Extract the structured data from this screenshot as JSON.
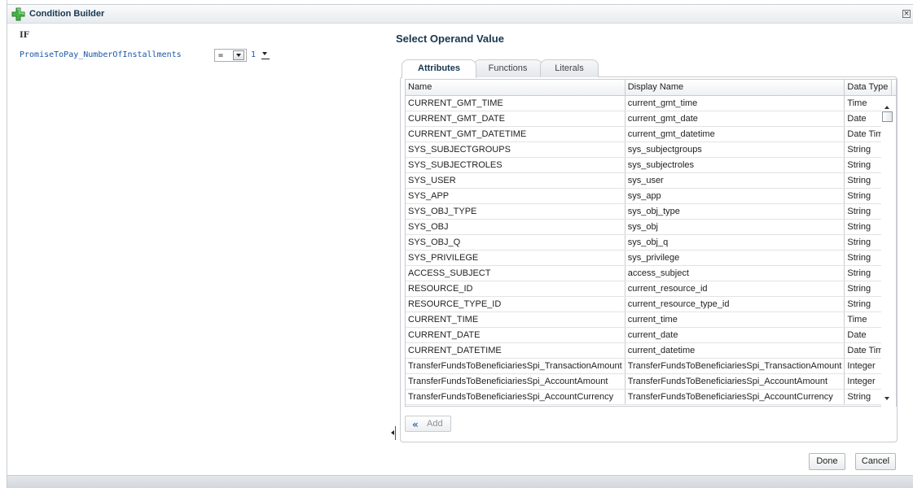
{
  "window": {
    "title": "Condition Builder"
  },
  "condition": {
    "keyword": "IF",
    "attribute": "PromiseToPay_NumberOfInstallments",
    "operator": "=",
    "operand": "1"
  },
  "operand_panel": {
    "title": "Select Operand Value",
    "tabs": [
      "Attributes",
      "Functions",
      "Literals"
    ],
    "active_tab": "Attributes",
    "columns": [
      "Name",
      "Display Name",
      "Data Type"
    ],
    "rows": [
      {
        "name": "CURRENT_GMT_TIME",
        "display": "current_gmt_time",
        "type": "Time"
      },
      {
        "name": "CURRENT_GMT_DATE",
        "display": "current_gmt_date",
        "type": "Date"
      },
      {
        "name": "CURRENT_GMT_DATETIME",
        "display": "current_gmt_datetime",
        "type": "Date Time"
      },
      {
        "name": "SYS_SUBJECTGROUPS",
        "display": "sys_subjectgroups",
        "type": "String"
      },
      {
        "name": "SYS_SUBJECTROLES",
        "display": "sys_subjectroles",
        "type": "String"
      },
      {
        "name": "SYS_USER",
        "display": "sys_user",
        "type": "String"
      },
      {
        "name": "SYS_APP",
        "display": "sys_app",
        "type": "String"
      },
      {
        "name": "SYS_OBJ_TYPE",
        "display": "sys_obj_type",
        "type": "String"
      },
      {
        "name": "SYS_OBJ",
        "display": "sys_obj",
        "type": "String"
      },
      {
        "name": "SYS_OBJ_Q",
        "display": "sys_obj_q",
        "type": "String"
      },
      {
        "name": "SYS_PRIVILEGE",
        "display": "sys_privilege",
        "type": "String"
      },
      {
        "name": "ACCESS_SUBJECT",
        "display": "access_subject",
        "type": "String"
      },
      {
        "name": "RESOURCE_ID",
        "display": "current_resource_id",
        "type": "String"
      },
      {
        "name": "RESOURCE_TYPE_ID",
        "display": "current_resource_type_id",
        "type": "String"
      },
      {
        "name": "CURRENT_TIME",
        "display": "current_time",
        "type": "Time"
      },
      {
        "name": "CURRENT_DATE",
        "display": "current_date",
        "type": "Date"
      },
      {
        "name": "CURRENT_DATETIME",
        "display": "current_datetime",
        "type": "Date Time"
      },
      {
        "name": "TransferFundsToBeneficiariesSpi_TransactionAmount",
        "display": "TransferFundsToBeneficiariesSpi_TransactionAmount",
        "type": "Integer"
      },
      {
        "name": "TransferFundsToBeneficiariesSpi_AccountAmount",
        "display": "TransferFundsToBeneficiariesSpi_AccountAmount",
        "type": "Integer"
      },
      {
        "name": "TransferFundsToBeneficiariesSpi_AccountCurrency",
        "display": "TransferFundsToBeneficiariesSpi_AccountCurrency",
        "type": "String"
      }
    ],
    "add_label": "Add"
  },
  "footer": {
    "done_label": "Done",
    "cancel_label": "Cancel"
  },
  "icons": {
    "title_icon": "green-plus-icon",
    "info_icon": "info-icon",
    "close_icon": "close-icon",
    "add_icon": "double-chevron-left-icon"
  },
  "colors": {
    "title_text": "#17364f",
    "link": "#1b56a8",
    "info_blue": "#1a5fc0",
    "add_icon_green": "#3aa53a"
  }
}
